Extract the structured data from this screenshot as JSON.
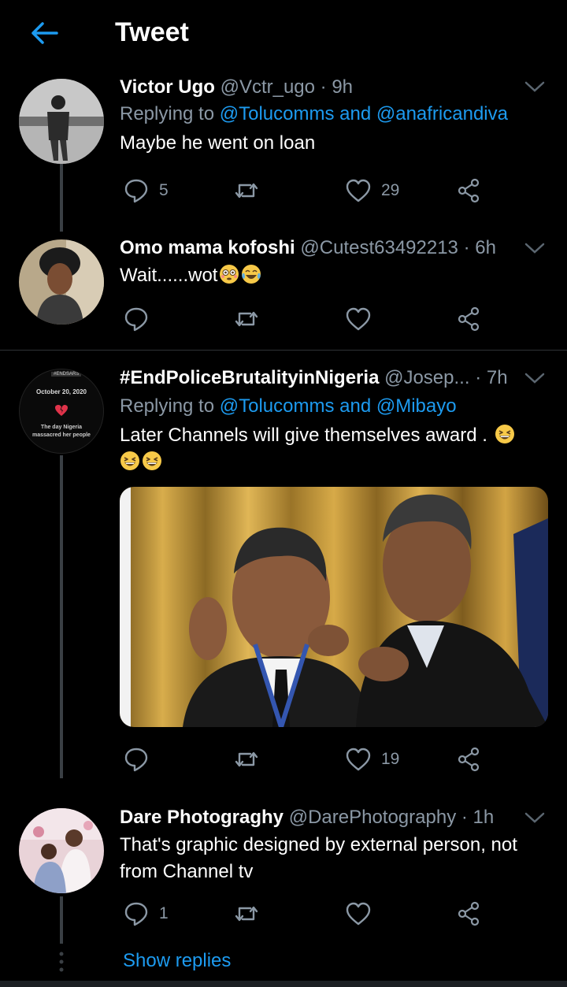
{
  "header": {
    "title": "Tweet",
    "back_icon": "arrow-left-icon"
  },
  "colors": {
    "accent": "#1d9bf0",
    "muted": "#8b98a5",
    "background": "#000000"
  },
  "tweets": [
    {
      "name": "Victor Ugo",
      "handle": "@Vctr_ugo",
      "time": "· 9h",
      "reply_prefix": "Replying to ",
      "reply_to": "@Tolucomms and @anafricandiva",
      "text": "Maybe he went on loan",
      "replies": "5",
      "retweets": "",
      "likes": "29"
    },
    {
      "name": "Omo mama kofoshi",
      "handle": "@Cutest63492213",
      "time": "· 6h",
      "text": "Wait......wot",
      "replies": "",
      "retweets": "",
      "likes": ""
    },
    {
      "name": "#EndPoliceBrutalityinNigeria",
      "handle": "@Josep...",
      "time": "· 7h",
      "reply_prefix": "Replying to ",
      "reply_to": "@Tolucomms and @Mibayo",
      "text": "Later Channels will give themselves award .",
      "replies": "",
      "retweets": "",
      "likes": "19",
      "avatar_date": "October 20, 2020",
      "avatar_caption_1": "The day Nigeria",
      "avatar_caption_2": "massacred her people",
      "avatar_tag": "#ENDSARS"
    },
    {
      "name": "Dare Photograghy",
      "handle": "@DarePhotography",
      "time": "· 1h",
      "text": "That's graphic designed by external person, not from Channel tv",
      "replies": "1",
      "retweets": "",
      "likes": ""
    }
  ],
  "show_replies": "Show replies"
}
